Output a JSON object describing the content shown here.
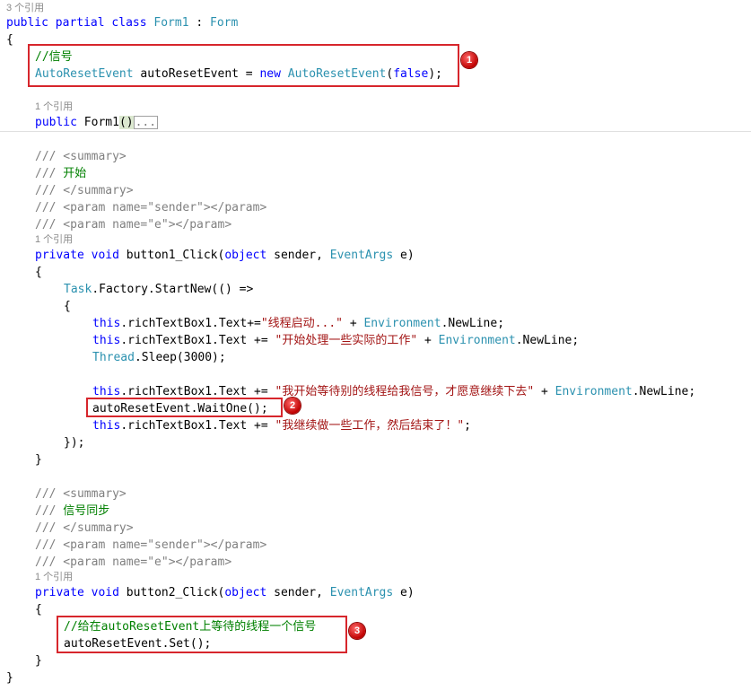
{
  "ref_labels": {
    "class_refs": "3 个引用",
    "one_ref": "1 个引用"
  },
  "code": {
    "class_kw1": "public",
    "class_kw2": "partial",
    "class_kw3": "class",
    "class_name": "Form1",
    "class_colon": " : ",
    "class_base": "Form",
    "open_brace": "{",
    "close_brace": "}",
    "signal_comment": "//信号",
    "field_type": "AutoResetEvent",
    "field_name": " autoResetEvent = ",
    "new_kw": "new",
    "ctor_type": "AutoResetEvent",
    "ctor_args_open": "(",
    "false_kw": "false",
    "ctor_args_close": ");",
    "ctor_public": "public",
    "ctor_name": " Form1",
    "ctor_parens": "()",
    "ctor_collapsed": "...",
    "doc_slash": "///",
    "doc_summary_open": " <summary>",
    "doc_summary_close": " </summary>",
    "doc_param_sender": " <param name=\"sender\"></param>",
    "doc_param_e": " <param name=\"e\"></param>",
    "doc_start": " 开始",
    "doc_signal_sync": " 信号同步",
    "private_kw": "private",
    "void_kw": "void",
    "btn1_name": " button1_Click(",
    "btn2_name": " button2_Click(",
    "object_kw": "object",
    "sender_param": " sender, ",
    "eventargs_type": "EventArgs",
    "e_param": " e)",
    "task_type": "Task",
    "task_call": ".Factory.StartNew(() =>",
    "this_kw": "this",
    "rtb_text_pluseq_nospace": ".richTextBox1.Text+=",
    "rtb_text_pluseq": ".richTextBox1.Text += ",
    "str_thread_start": "\"线程启动...\"",
    "str_start_work": "\"开始处理一些实际的工作\"",
    "str_wait_signal": "\"我开始等待别的线程给我信号，才愿意继续下去\"",
    "str_continue": "\"我继续做一些工作，然后结束了！\"",
    "plus_sep": " + ",
    "env_type": "Environment",
    "newline_end": ".NewLine;",
    "thread_type": "Thread",
    "sleep_call": ".Sleep(3000);",
    "waitone_call": "autoResetEvent.WaitOne();",
    "semicolon": ";",
    "close_task": "});",
    "set_comment": "//给在autoResetEvent上等待的线程一个信号",
    "set_call": "autoResetEvent.Set();"
  },
  "badges": {
    "b1": "1",
    "b2": "2",
    "b3": "3"
  }
}
